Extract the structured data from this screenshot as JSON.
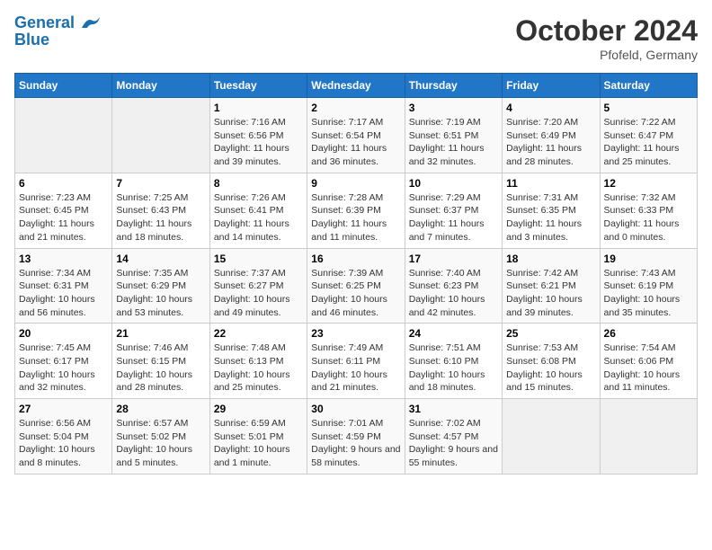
{
  "header": {
    "logo_line1": "General",
    "logo_line2": "Blue",
    "month": "October 2024",
    "location": "Pfofeld, Germany"
  },
  "weekdays": [
    "Sunday",
    "Monday",
    "Tuesday",
    "Wednesday",
    "Thursday",
    "Friday",
    "Saturday"
  ],
  "weeks": [
    [
      null,
      null,
      {
        "day": 1,
        "sunrise": "7:16 AM",
        "sunset": "6:56 PM",
        "daylight": "11 hours and 39 minutes."
      },
      {
        "day": 2,
        "sunrise": "7:17 AM",
        "sunset": "6:54 PM",
        "daylight": "11 hours and 36 minutes."
      },
      {
        "day": 3,
        "sunrise": "7:19 AM",
        "sunset": "6:51 PM",
        "daylight": "11 hours and 32 minutes."
      },
      {
        "day": 4,
        "sunrise": "7:20 AM",
        "sunset": "6:49 PM",
        "daylight": "11 hours and 28 minutes."
      },
      {
        "day": 5,
        "sunrise": "7:22 AM",
        "sunset": "6:47 PM",
        "daylight": "11 hours and 25 minutes."
      }
    ],
    [
      {
        "day": 6,
        "sunrise": "7:23 AM",
        "sunset": "6:45 PM",
        "daylight": "11 hours and 21 minutes."
      },
      {
        "day": 7,
        "sunrise": "7:25 AM",
        "sunset": "6:43 PM",
        "daylight": "11 hours and 18 minutes."
      },
      {
        "day": 8,
        "sunrise": "7:26 AM",
        "sunset": "6:41 PM",
        "daylight": "11 hours and 14 minutes."
      },
      {
        "day": 9,
        "sunrise": "7:28 AM",
        "sunset": "6:39 PM",
        "daylight": "11 hours and 11 minutes."
      },
      {
        "day": 10,
        "sunrise": "7:29 AM",
        "sunset": "6:37 PM",
        "daylight": "11 hours and 7 minutes."
      },
      {
        "day": 11,
        "sunrise": "7:31 AM",
        "sunset": "6:35 PM",
        "daylight": "11 hours and 3 minutes."
      },
      {
        "day": 12,
        "sunrise": "7:32 AM",
        "sunset": "6:33 PM",
        "daylight": "11 hours and 0 minutes."
      }
    ],
    [
      {
        "day": 13,
        "sunrise": "7:34 AM",
        "sunset": "6:31 PM",
        "daylight": "10 hours and 56 minutes."
      },
      {
        "day": 14,
        "sunrise": "7:35 AM",
        "sunset": "6:29 PM",
        "daylight": "10 hours and 53 minutes."
      },
      {
        "day": 15,
        "sunrise": "7:37 AM",
        "sunset": "6:27 PM",
        "daylight": "10 hours and 49 minutes."
      },
      {
        "day": 16,
        "sunrise": "7:39 AM",
        "sunset": "6:25 PM",
        "daylight": "10 hours and 46 minutes."
      },
      {
        "day": 17,
        "sunrise": "7:40 AM",
        "sunset": "6:23 PM",
        "daylight": "10 hours and 42 minutes."
      },
      {
        "day": 18,
        "sunrise": "7:42 AM",
        "sunset": "6:21 PM",
        "daylight": "10 hours and 39 minutes."
      },
      {
        "day": 19,
        "sunrise": "7:43 AM",
        "sunset": "6:19 PM",
        "daylight": "10 hours and 35 minutes."
      }
    ],
    [
      {
        "day": 20,
        "sunrise": "7:45 AM",
        "sunset": "6:17 PM",
        "daylight": "10 hours and 32 minutes."
      },
      {
        "day": 21,
        "sunrise": "7:46 AM",
        "sunset": "6:15 PM",
        "daylight": "10 hours and 28 minutes."
      },
      {
        "day": 22,
        "sunrise": "7:48 AM",
        "sunset": "6:13 PM",
        "daylight": "10 hours and 25 minutes."
      },
      {
        "day": 23,
        "sunrise": "7:49 AM",
        "sunset": "6:11 PM",
        "daylight": "10 hours and 21 minutes."
      },
      {
        "day": 24,
        "sunrise": "7:51 AM",
        "sunset": "6:10 PM",
        "daylight": "10 hours and 18 minutes."
      },
      {
        "day": 25,
        "sunrise": "7:53 AM",
        "sunset": "6:08 PM",
        "daylight": "10 hours and 15 minutes."
      },
      {
        "day": 26,
        "sunrise": "7:54 AM",
        "sunset": "6:06 PM",
        "daylight": "10 hours and 11 minutes."
      }
    ],
    [
      {
        "day": 27,
        "sunrise": "6:56 AM",
        "sunset": "5:04 PM",
        "daylight": "10 hours and 8 minutes."
      },
      {
        "day": 28,
        "sunrise": "6:57 AM",
        "sunset": "5:02 PM",
        "daylight": "10 hours and 5 minutes."
      },
      {
        "day": 29,
        "sunrise": "6:59 AM",
        "sunset": "5:01 PM",
        "daylight": "10 hours and 1 minute."
      },
      {
        "day": 30,
        "sunrise": "7:01 AM",
        "sunset": "4:59 PM",
        "daylight": "9 hours and 58 minutes."
      },
      {
        "day": 31,
        "sunrise": "7:02 AM",
        "sunset": "4:57 PM",
        "daylight": "9 hours and 55 minutes."
      },
      null,
      null
    ]
  ]
}
